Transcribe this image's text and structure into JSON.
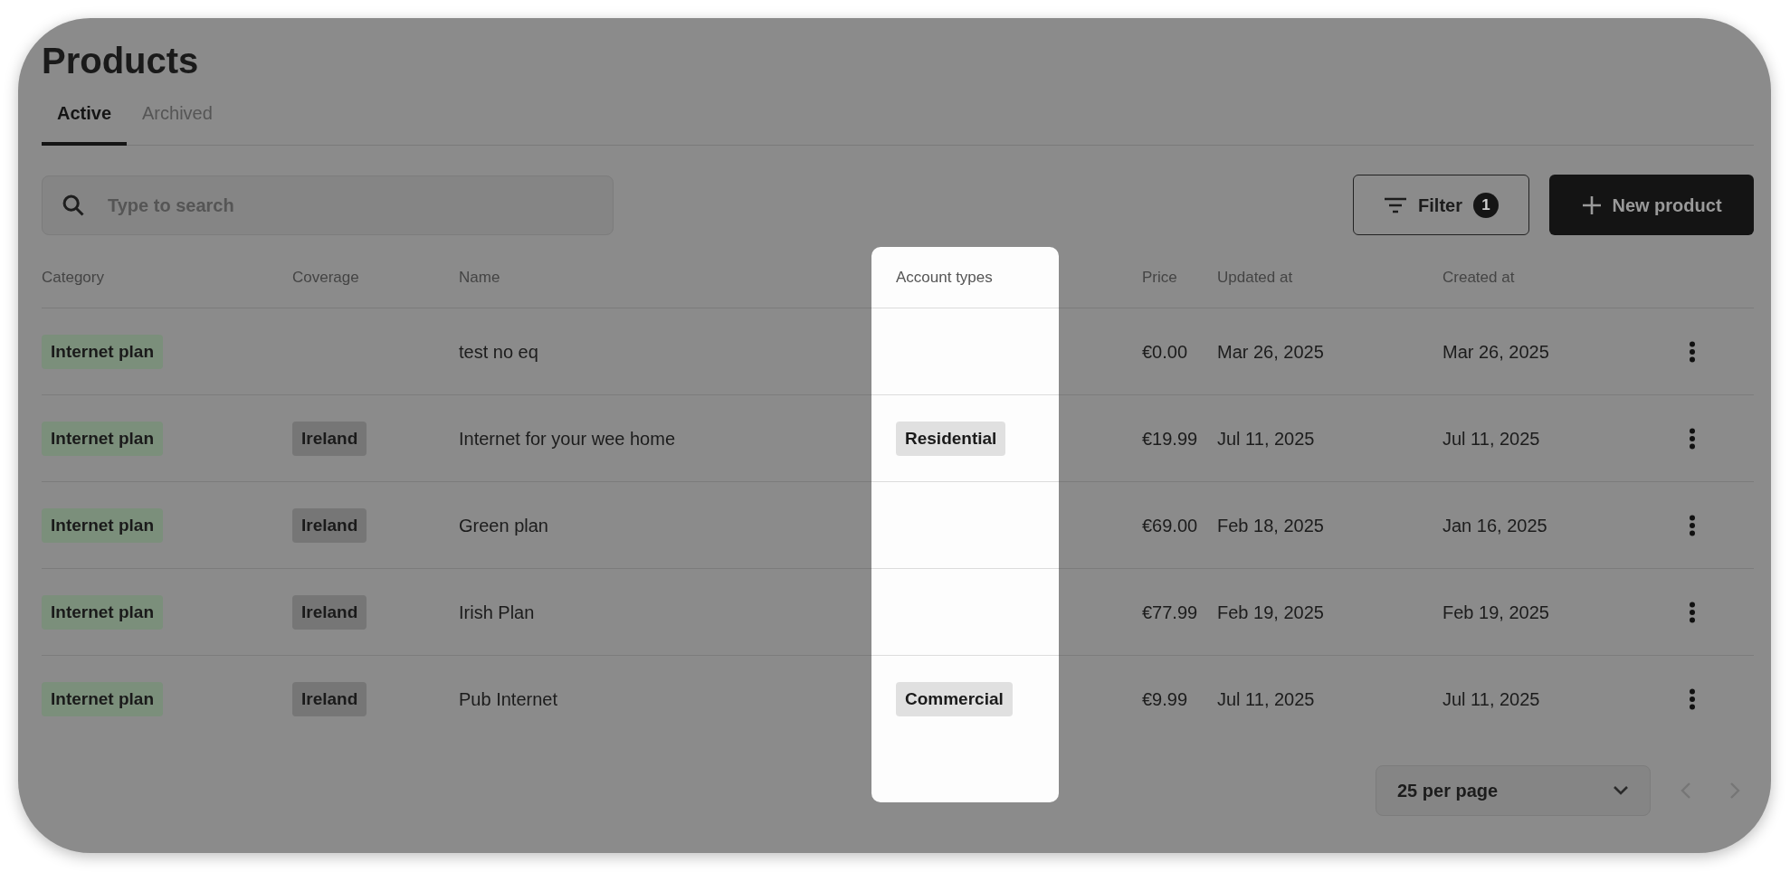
{
  "title": "Products",
  "tabs": [
    {
      "label": "Active",
      "selected": true
    },
    {
      "label": "Archived",
      "selected": false
    }
  ],
  "search": {
    "placeholder": "Type to search"
  },
  "filter_button": {
    "label": "Filter",
    "count": "1"
  },
  "new_button": {
    "label": "New product"
  },
  "table": {
    "columns": [
      {
        "label": "Category",
        "kind": "green_tag",
        "highlighted": false
      },
      {
        "label": "Coverage",
        "kind": "gray_tag",
        "highlighted": false
      },
      {
        "label": "Name",
        "kind": "text",
        "highlighted": false
      },
      {
        "label": "Account types",
        "kind": "light_tag",
        "highlighted": true
      },
      {
        "label": "Price",
        "kind": "text",
        "highlighted": false
      },
      {
        "label": "Updated at",
        "kind": "text",
        "highlighted": false
      },
      {
        "label": "Created at",
        "kind": "text",
        "highlighted": false
      }
    ],
    "rows": [
      {
        "cells": [
          "Internet plan",
          null,
          "test no eq",
          null,
          "€0.00",
          "Mar 26, 2025",
          "Mar 26, 2025"
        ]
      },
      {
        "cells": [
          "Internet plan",
          "Ireland",
          "Internet for your wee home",
          "Residential",
          "€19.99",
          "Jul 11, 2025",
          "Jul 11, 2025"
        ]
      },
      {
        "cells": [
          "Internet plan",
          "Ireland",
          "Green plan",
          null,
          "€69.00",
          "Feb 18, 2025",
          "Jan 16, 2025"
        ]
      },
      {
        "cells": [
          "Internet plan",
          "Ireland",
          "Irish Plan",
          null,
          "€77.99",
          "Feb 19, 2025",
          "Feb 19, 2025"
        ]
      },
      {
        "cells": [
          "Internet plan",
          "Ireland",
          "Pub Internet",
          "Commercial",
          "€9.99",
          "Jul 11, 2025",
          "Jul 11, 2025"
        ]
      }
    ]
  },
  "pagination": {
    "per_page": "25 per page"
  }
}
